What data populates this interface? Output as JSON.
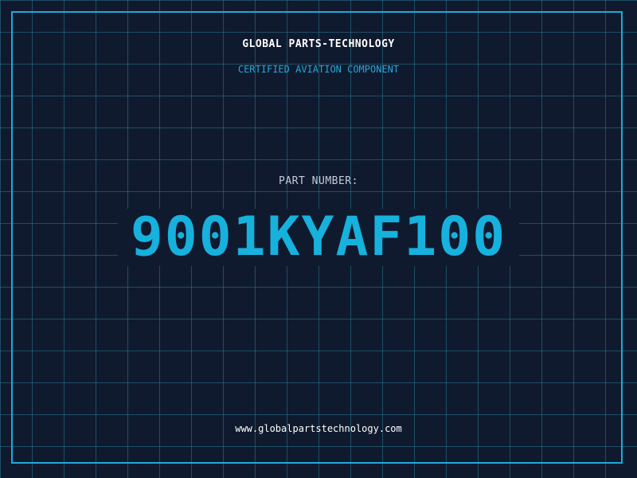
{
  "header": {
    "company": "GLOBAL PARTS-TECHNOLOGY",
    "certification": "CERTIFIED AVIATION COMPONENT"
  },
  "part": {
    "label": "PART NUMBER:",
    "number": "9001KYAF100"
  },
  "footer": {
    "url": "www.globalpartstechnology.com"
  },
  "colors": {
    "background": "#101a2e",
    "grid": "#2a7891",
    "accent": "#1fa9d6",
    "text": "#ffffff"
  }
}
